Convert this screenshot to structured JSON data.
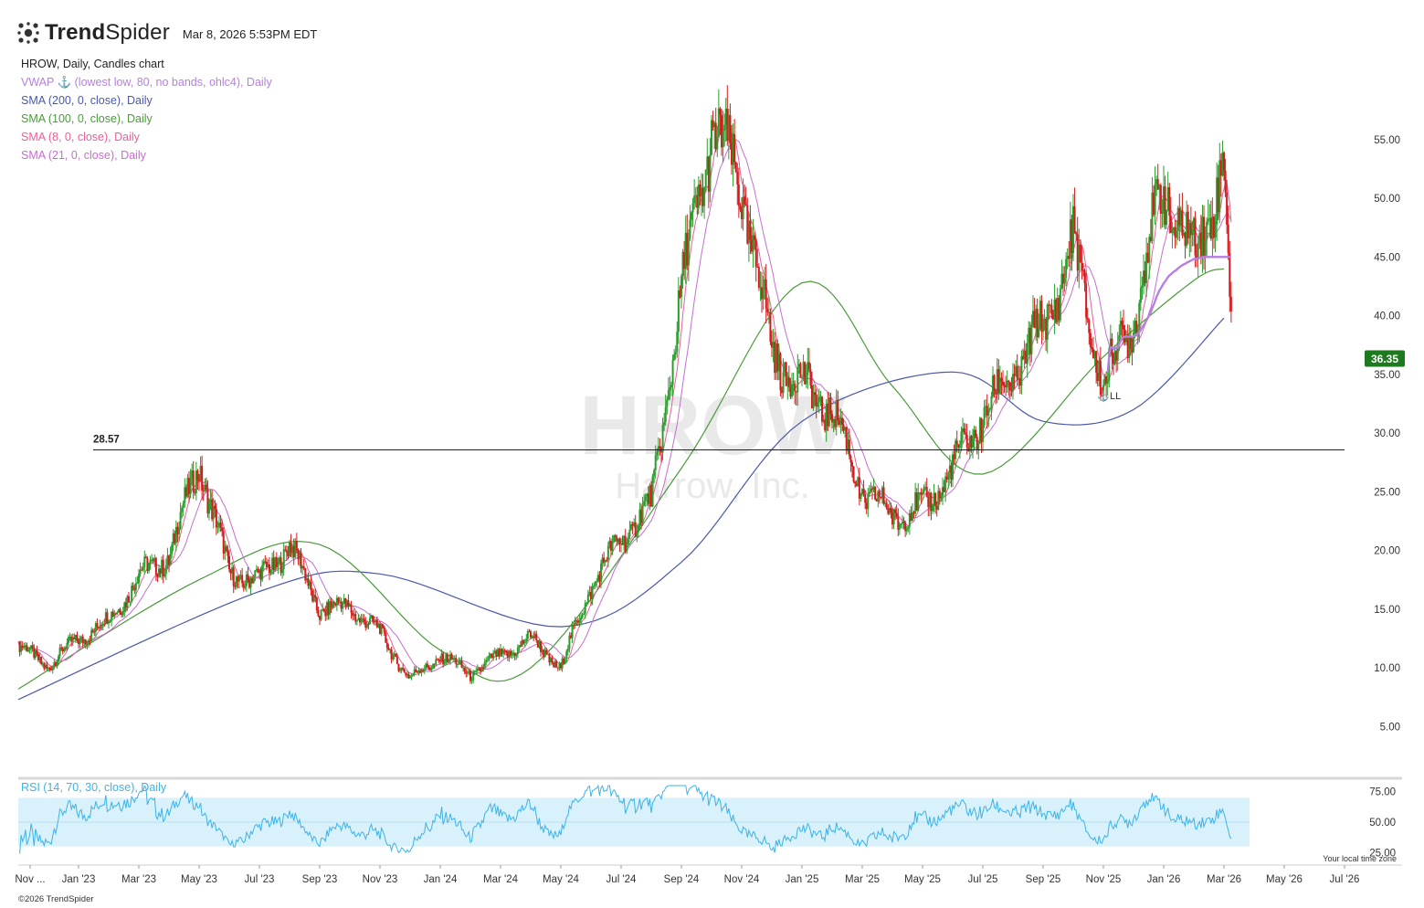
{
  "header": {
    "brand_bold": "Trend",
    "brand_light": "Spider",
    "timestamp": "Mar 8, 2026 5:53PM EDT"
  },
  "legend": {
    "title": "HROW, Daily, Candles chart",
    "indicators": [
      {
        "label": "VWAP ⚓ (lowest low, 80, no bands, ohlc4), Daily",
        "color": "#b67fe0"
      },
      {
        "label": "SMA (200, 0, close), Daily",
        "color": "#4a58a8"
      },
      {
        "label": "SMA (100, 0, close), Daily",
        "color": "#4a9a3a"
      },
      {
        "label": "SMA (8, 0, close), Daily",
        "color": "#e8609a"
      },
      {
        "label": "SMA (21, 0, close), Daily",
        "color": "#c46fd0"
      }
    ]
  },
  "watermark": {
    "ticker": "HROW",
    "company": "Harrow, Inc."
  },
  "rsi": {
    "label": "RSI (14, 70, 30, close), Daily",
    "color": "#3db3e6"
  },
  "footer": {
    "copyright": "©2026 TrendSpider",
    "tz_note": "Your local time zone"
  },
  "colors": {
    "up": "#2a9d2a",
    "down": "#d7191c",
    "price_badge": "#1e7a1e",
    "axis_text": "#333333",
    "rsi_band": "#d8f1fa"
  },
  "chart_data": {
    "type": "candlestick",
    "symbol": "HROW",
    "last_price": "36.35",
    "horizontal_line": {
      "value": 28.57,
      "label": "28.57"
    },
    "annotation": {
      "label": "⚓LL",
      "date": "Nov '25",
      "value": 33.2
    },
    "y_ticks": [
      "55.00",
      "50.00",
      "45.00",
      "40.00",
      "35.00",
      "30.00",
      "25.00",
      "20.00",
      "15.00",
      "10.00",
      "5.00"
    ],
    "y_tick_values": [
      55,
      50,
      45,
      40,
      35,
      30,
      25,
      20,
      15,
      10,
      5
    ],
    "ylim": [
      2.3,
      59.5
    ],
    "x_ticks": [
      "Nov ...",
      "Jan '23",
      "Mar '23",
      "May '23",
      "Jul '23",
      "Sep '23",
      "Nov '23",
      "Jan '24",
      "Mar '24",
      "May '24",
      "Jul '24",
      "Sep '24",
      "Nov '24",
      "Jan '25",
      "Mar '25",
      "May '25",
      "Jul '25",
      "Sep '25",
      "Nov '25",
      "Jan '26",
      "Mar '26",
      "May '26",
      "Jul '26"
    ],
    "price_path": [
      [
        "Nov 2022",
        11.8
      ],
      [
        "Dec 2022",
        10.2
      ],
      [
        "Jan 2023",
        12.5
      ],
      [
        "Feb 2023",
        14.0
      ],
      [
        "Mar 2023",
        17.8
      ],
      [
        "Apr 2023",
        19.5
      ],
      [
        "May 2023",
        27.5
      ],
      [
        "Jun 2023",
        18.0
      ],
      [
        "Jul 2023",
        17.5
      ],
      [
        "Aug 2023",
        20.5
      ],
      [
        "Sep 2023",
        15.0
      ],
      [
        "Oct 2023",
        15.2
      ],
      [
        "Nov 2023",
        13.0
      ],
      [
        "Dec 2023",
        9.0
      ],
      [
        "Jan 2024",
        11.0
      ],
      [
        "Feb 2024",
        9.5
      ],
      [
        "Mar 2024",
        11.0
      ],
      [
        "Apr 2024",
        12.5
      ],
      [
        "May 2024",
        10.0
      ],
      [
        "Jun 2024",
        17.0
      ],
      [
        "Jul 2024",
        21.0
      ],
      [
        "Aug 2024",
        24.0
      ],
      [
        "Sep 2024",
        42.0
      ],
      [
        "Oct 2024",
        56.0
      ],
      [
        "Nov 2024",
        51.0
      ],
      [
        "Dec 2024",
        37.0
      ],
      [
        "Jan 2025",
        34.0
      ],
      [
        "Feb 2025",
        32.0
      ],
      [
        "Mar 2025",
        25.0
      ],
      [
        "Apr 2025",
        23.0
      ],
      [
        "May 2025",
        23.5
      ],
      [
        "Jun 2025",
        27.0
      ],
      [
        "Jul 2025",
        31.5
      ],
      [
        "Aug 2025",
        35.0
      ],
      [
        "Sep 2025",
        39.0
      ],
      [
        "Oct 2025",
        46.0
      ],
      [
        "Nov 2025",
        34.0
      ],
      [
        "Dec 2025",
        40.0
      ],
      [
        "Jan 2026",
        51.0
      ],
      [
        "Feb 2026",
        45.0
      ],
      [
        "Mar 2026",
        53.0
      ],
      [
        "Mar 8 2026",
        36.35
      ]
    ],
    "sma_200": [
      [
        "Nov 2022",
        7.3
      ],
      [
        "Jul 2023",
        16.5
      ],
      [
        "Nov 2023",
        18.0
      ],
      [
        "May 2024",
        13.5
      ],
      [
        "Sep 2024",
        19.0
      ],
      [
        "Jan 2025",
        31.0
      ],
      [
        "Jun 2025",
        35.2
      ],
      [
        "Sep 2025",
        31.0
      ],
      [
        "Dec 2025",
        32.0
      ],
      [
        "Mar 2026",
        39.8
      ]
    ],
    "sma_100": [
      [
        "Nov 2022",
        8.2
      ],
      [
        "May 2023",
        17.5
      ],
      [
        "Sep 2023",
        20.5
      ],
      [
        "Jan 2024",
        11.5
      ],
      [
        "Apr 2024",
        10.0
      ],
      [
        "Sep 2024",
        27.0
      ],
      [
        "Jan 2025",
        42.8
      ],
      [
        "Apr 2025",
        34.0
      ],
      [
        "Jul 2025",
        26.5
      ],
      [
        "Nov 2025",
        36.5
      ],
      [
        "Feb 2026",
        43.0
      ],
      [
        "Mar 2026",
        44.0
      ]
    ]
  }
}
